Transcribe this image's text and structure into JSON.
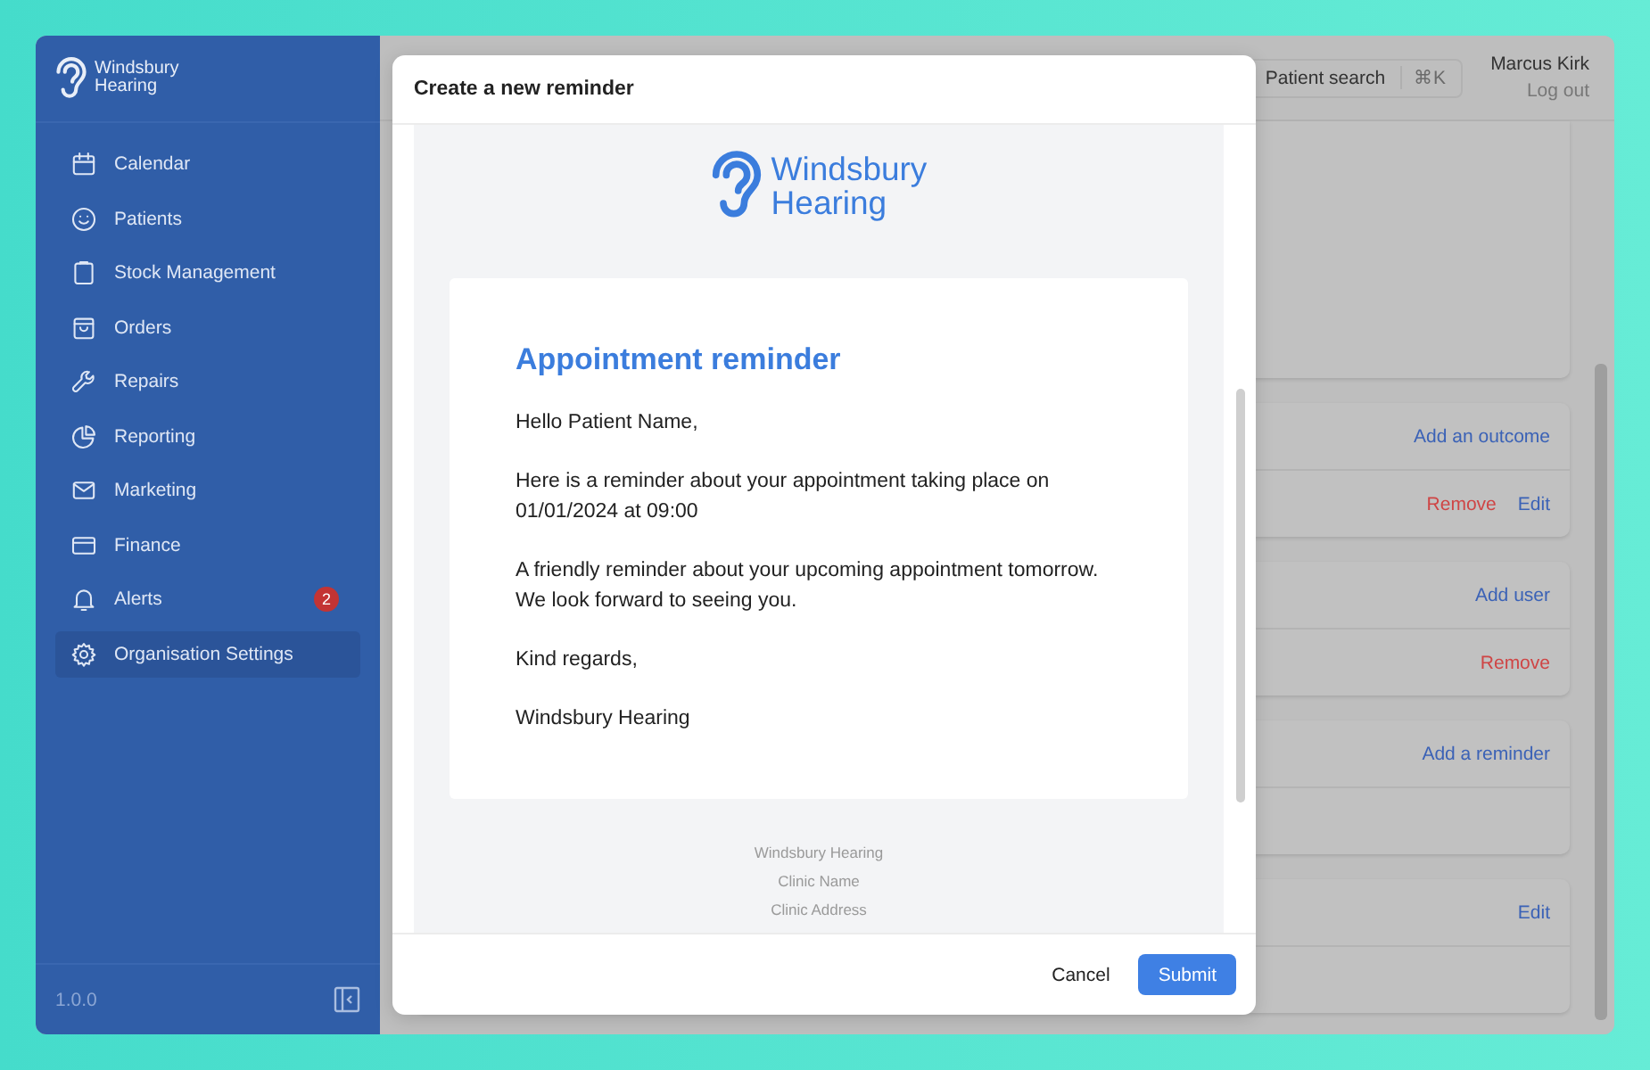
{
  "sidebar": {
    "logo": {
      "line1": "Windsbury",
      "line2": "Hearing"
    },
    "items": [
      {
        "label": "Calendar",
        "selected": false
      },
      {
        "label": "Patients",
        "selected": false
      },
      {
        "label": "Stock Management",
        "selected": false
      },
      {
        "label": "Orders",
        "selected": false
      },
      {
        "label": "Repairs",
        "selected": false
      },
      {
        "label": "Reporting",
        "selected": false
      },
      {
        "label": "Marketing",
        "selected": false
      },
      {
        "label": "Finance",
        "selected": false
      },
      {
        "label": "Alerts",
        "selected": false,
        "badge": "2"
      },
      {
        "label": "Organisation Settings",
        "selected": true
      }
    ],
    "version": "1.0.0"
  },
  "header": {
    "search": {
      "placeholder": "Patient search",
      "shortcut": "⌘K"
    },
    "user": {
      "name": "Marcus Kirk",
      "logout": "Log out"
    }
  },
  "cards": [
    {
      "rows": [
        {
          "actions": []
        }
      ]
    },
    {
      "rows": [
        {
          "actions": [
            {
              "label": "Add an outcome",
              "kind": "link"
            }
          ]
        },
        {
          "actions": [
            {
              "label": "Remove",
              "kind": "danger"
            },
            {
              "label": "Edit",
              "kind": "link"
            }
          ]
        }
      ]
    },
    {
      "rows": [
        {
          "actions": [
            {
              "label": "Add user",
              "kind": "link"
            }
          ]
        },
        {
          "actions": [
            {
              "label": "Remove",
              "kind": "danger"
            }
          ]
        }
      ]
    },
    {
      "rows": [
        {
          "actions": [
            {
              "label": "Add a reminder",
              "kind": "link"
            }
          ]
        },
        {
          "actions": []
        }
      ]
    },
    {
      "rows": [
        {
          "actions": [
            {
              "label": "Edit",
              "kind": "link"
            }
          ]
        },
        {
          "actions": []
        }
      ]
    }
  ],
  "modal": {
    "title": "Create a new reminder",
    "email": {
      "logo": {
        "line1": "Windsbury",
        "line2": "Hearing"
      },
      "heading": "Appointment reminder",
      "paragraphs": [
        [
          "Hello Patient Name,"
        ],
        [
          "Here is a reminder about your appointment taking place on",
          "01/01/2024 at 09:00"
        ],
        [
          "A friendly reminder about your upcoming appointment tomorrow.",
          "We look forward to seeing you."
        ],
        [
          "Kind regards,"
        ],
        [
          "Windsbury Hearing"
        ]
      ],
      "footer": [
        "Windsbury Hearing",
        "Clinic Name",
        "Clinic Address"
      ]
    },
    "buttons": {
      "cancel": "Cancel",
      "submit": "Submit"
    }
  }
}
